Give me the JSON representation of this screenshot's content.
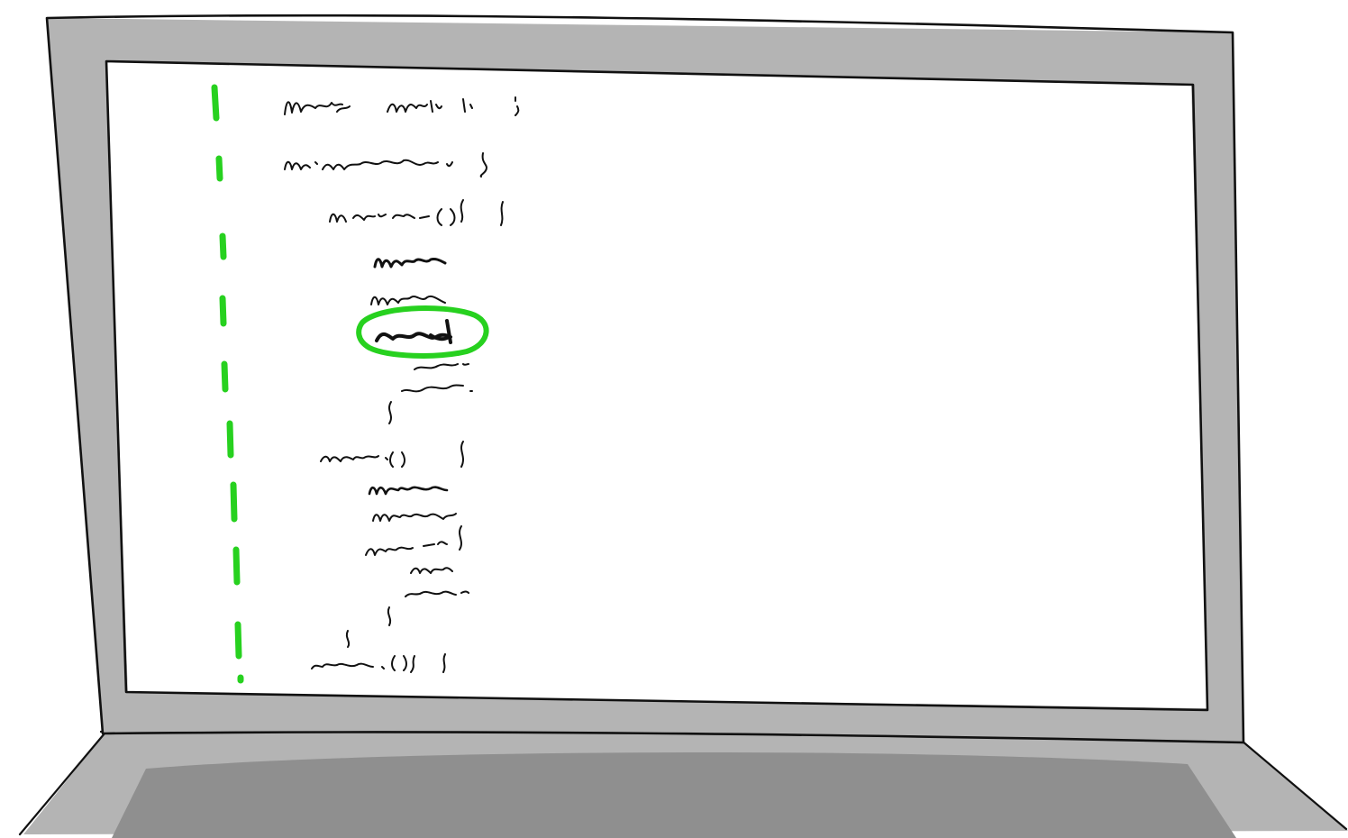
{
  "illustration": {
    "subject": "laptop-sketch",
    "style": "hand-drawn",
    "colors": {
      "bezel": "#b4b4b4",
      "keyboard_deck": "#8f8f8f",
      "screen": "#ffffff",
      "outline": "#111111",
      "accent": "#27d11f"
    }
  },
  "code_view": {
    "lines_are_legible": false,
    "indent_levels": [
      0,
      0,
      1,
      2,
      2,
      2,
      3,
      3,
      2,
      1,
      2,
      2,
      2,
      3,
      3,
      2,
      1,
      1
    ],
    "highlighted_line_index": 5,
    "highlight_shape": "circle",
    "gutter_marker": "dashed-vertical-line"
  }
}
